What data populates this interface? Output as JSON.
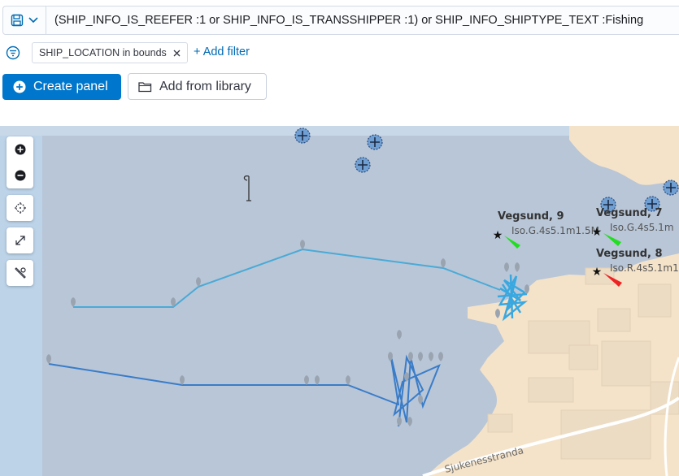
{
  "query_bar": {
    "saved_query_icon": "save-icon",
    "dropdown_icon": "chevron-down-icon",
    "query": "(SHIP_INFO_IS_REEFER :1 or SHIP_INFO_IS_TRANSSHIPPER :1) or SHIP_INFO_SHIPTYPE_TEXT :Fishing"
  },
  "filter_bar": {
    "filter_menu_icon": "filter-menu-icon",
    "filters": [
      {
        "label": "SHIP_LOCATION in bounds",
        "remove_icon": "close-icon"
      }
    ],
    "add_filter_label": "+ Add filter"
  },
  "panel_actions": {
    "create_panel_label": "Create panel",
    "add_from_library_label": "Add from library"
  },
  "map": {
    "controls": [
      "zoom-in-icon",
      "zoom-out-icon",
      "locate-icon",
      "fullscreen-icon",
      "tools-icon"
    ],
    "colors": {
      "water": "#b9c8d8",
      "land": "#f4e3c9",
      "track_light": "#4aaad6",
      "track_dark": "#3a7cc8",
      "light_green": "#22dd22",
      "light_red": "#ee2222"
    },
    "beacons": [
      {
        "name": "Vegsund, 9",
        "detail": "Iso.G.4s5.1m1.5M"
      },
      {
        "name": "Vegsund, 7",
        "detail": "Iso.G.4s5.1m"
      },
      {
        "name": "Vegsund, 8",
        "detail": "Iso.R.4s5.1m1"
      }
    ],
    "road_label": "Sjukenesstranda"
  }
}
